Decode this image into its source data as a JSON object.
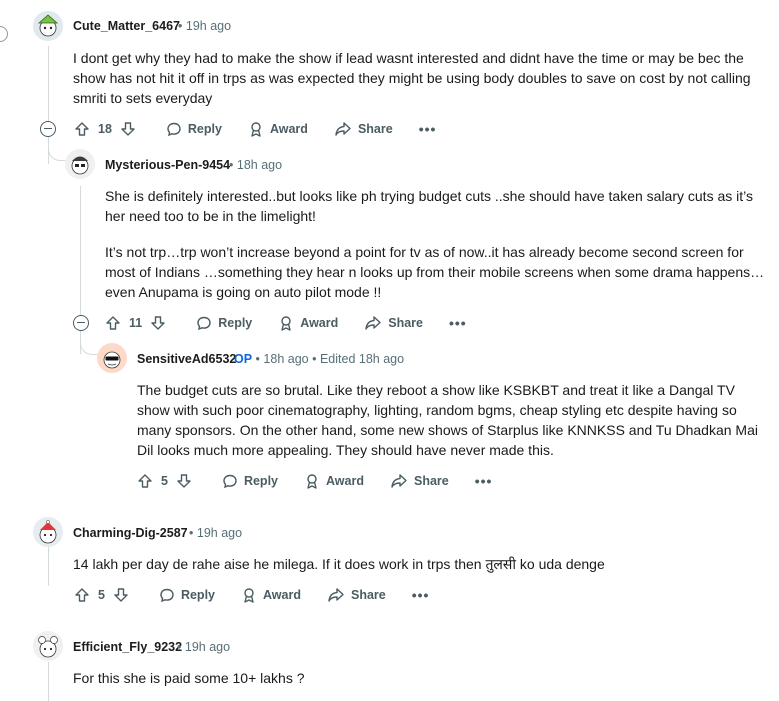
{
  "comments": [
    {
      "username": "Cute_Matter_6467",
      "time": "19h ago",
      "body": [
        "I dont get why they had to make the show if lead wasnt interested and didnt have the time or may be bec the show has not hit it off in trps as was expected they might be using body doubles to save on cost by not calling smriti to sets everyday"
      ],
      "votes": "18"
    },
    {
      "username": "Mysterious-Pen-9454",
      "time": "18h ago",
      "body": [
        "She is definitely interested..but looks like ph trying budget cuts ..she should have taken salary cuts as it’s her need too to be in the limelight!",
        "It’s not trp…trp won’t increase beyond a point for tv as of now..it has already become second screen for most of Indians …something they hear n looks up from their mobile screens when some drama happens… even Anupama is going on auto pilot mode !!"
      ],
      "votes": "11"
    },
    {
      "username": "SensitiveAd6532",
      "op_label": "OP",
      "time": "18h ago",
      "edited": "Edited 18h ago",
      "body": [
        "The budget cuts are so brutal. Like they reboot a show like KSBKBT and treat it like a Dangal TV show with such poor cinematography, lighting, random bgms, cheap styling etc despite having so many sponsors. On the other hand, some new shows of Starplus like KNNKSS and Tu Dhadkan Mai Dil looks much more appealing. They should have never made this."
      ],
      "votes": "5"
    },
    {
      "username": "Charming-Dig-2587",
      "time": "19h ago",
      "body": [
        "14 lakh per day de rahe aise he milega. If it does work in trps then तुलसी ko uda denge"
      ],
      "votes": "5"
    },
    {
      "username": "Efficient_Fly_9232",
      "time": "19h ago",
      "body": [
        "For this she is paid some 10+ lakhs ?"
      ]
    }
  ],
  "actions": {
    "reply": "Reply",
    "award": "Award",
    "share": "Share",
    "more": "•••"
  },
  "separator": "•",
  "icons": [
    "upvote-icon",
    "downvote-icon",
    "reply-icon",
    "award-icon",
    "share-icon",
    "collapse-icon",
    "more-icon"
  ]
}
